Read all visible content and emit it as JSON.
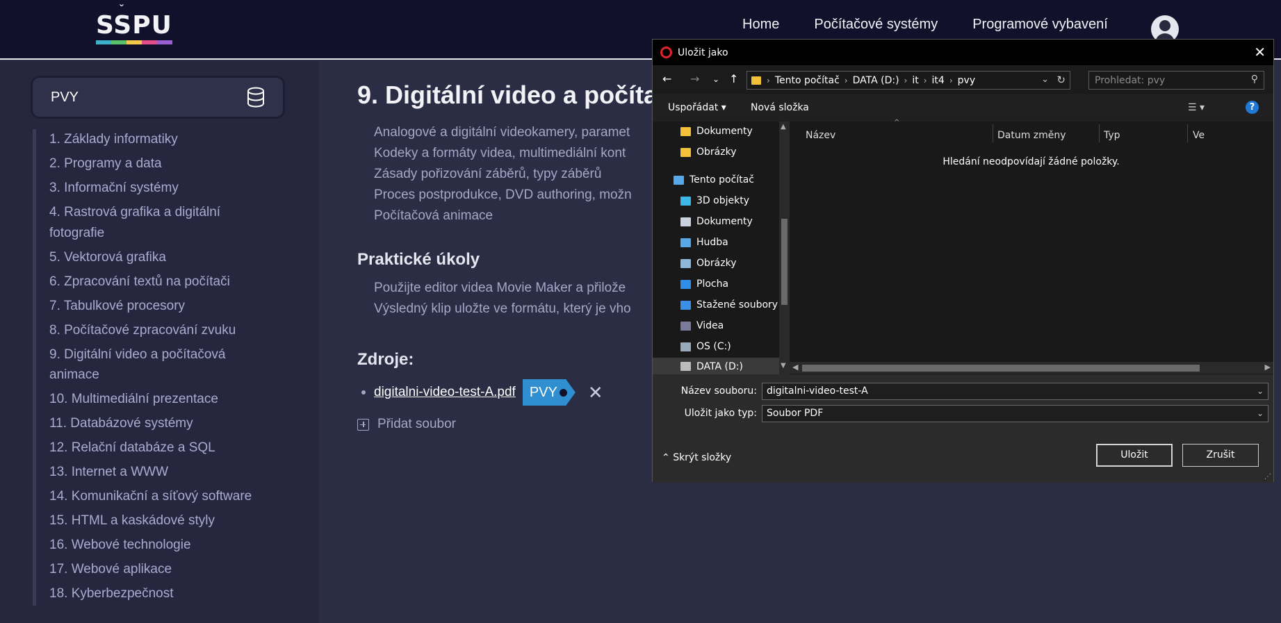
{
  "header": {
    "logo_text": "SSPU",
    "logo_caron": "ˇ",
    "logo_colors": [
      "#3fb0c9",
      "#5bc06a",
      "#f2c84b",
      "#e44d8a",
      "#9b5fd1"
    ],
    "nav": [
      "Home",
      "Počítačové systémy",
      "Programové vybavení"
    ]
  },
  "sidebar": {
    "subject": "PVY",
    "chapters": [
      "1. Základy informatiky",
      "2. Programy a data",
      "3. Informační systémy",
      "4. Rastrová grafika a digitální fotografie",
      "5. Vektorová grafika",
      "6. Zpracování textů na počítači",
      "7. Tabulkové procesory",
      "8. Počítačové zpracování zvuku",
      "9. Digitální video a počítačová animace",
      "10. Multimediální prezentace",
      "11. Databázové systémy",
      "12. Relační databáze a SQL",
      "13. Internet a WWW",
      "14. Komunikační a síťový software",
      "15. HTML a kaskádové styly",
      "16. Webové technologie",
      "17. Webové aplikace",
      "18. Kyberbezpečnost"
    ]
  },
  "content": {
    "title": "9. Digitální video a počíta",
    "topics": [
      "Analogové a digitální videokamery, paramet",
      "Kodeky a formáty videa, multimediální kont",
      "Zásady pořizování záběrů, typy záběrů",
      "Proces postprodukce, DVD authoring, možn",
      "Počítačová animace"
    ],
    "tasks_title": "Praktické úkoly",
    "tasks": [
      "Použijte editor videa Movie Maker a přilože",
      "Výsledný klip uložte ve formátu, který je vho"
    ],
    "sources_title": "Zdroje:",
    "file_name": "digitalni-video-test-A.pdf",
    "file_tag": "PVY",
    "remove_icon": "✕",
    "add_file_label": "Přidat soubor"
  },
  "dialog": {
    "title": "Uložit jako",
    "close": "✕",
    "address": [
      "Tento počítač",
      "DATA (D:)",
      "it",
      "it4",
      "pvy"
    ],
    "search_placeholder": "Prohledat: pvy",
    "organize": "Uspořádat ▾",
    "new_folder": "Nová složka",
    "help": "?",
    "nav_items": [
      {
        "label": "Dokumenty",
        "icon": "folder-icon",
        "color": "#f3c13a"
      },
      {
        "label": "Obrázky",
        "icon": "folder-icon",
        "color": "#f3c13a"
      },
      {
        "label": "Tento počítač",
        "icon": "computer-icon",
        "color": "#56a8e8"
      },
      {
        "label": "3D objekty",
        "icon": "cube-icon",
        "color": "#3cb8e8"
      },
      {
        "label": "Dokumenty",
        "icon": "document-icon",
        "color": "#c9d3e0"
      },
      {
        "label": "Hudba",
        "icon": "music-icon",
        "color": "#56a8e8"
      },
      {
        "label": "Obrázky",
        "icon": "pictures-icon",
        "color": "#8fb8d8"
      },
      {
        "label": "Plocha",
        "icon": "desktop-icon",
        "color": "#2f8fe8"
      },
      {
        "label": "Stažené soubory",
        "icon": "download-icon",
        "color": "#3c8fe8"
      },
      {
        "label": "Videa",
        "icon": "video-icon",
        "color": "#7a7a9a"
      },
      {
        "label": "OS (C:)",
        "icon": "drive-icon",
        "color": "#9ab"
      },
      {
        "label": "DATA (D:)",
        "icon": "drive-icon",
        "color": "#bbb"
      }
    ],
    "columns": [
      "Název",
      "Datum změny",
      "Typ",
      "Ve"
    ],
    "empty_message": "Hledání neodpovídají žádné položky.",
    "filename_label": "Název souboru:",
    "filename_value": "digitalni-video-test-A",
    "filetype_label": "Uložit jako typ:",
    "filetype_value": "Soubor PDF",
    "hide_folders": "Skrýt složky",
    "save": "Uložit",
    "cancel": "Zrušit"
  }
}
